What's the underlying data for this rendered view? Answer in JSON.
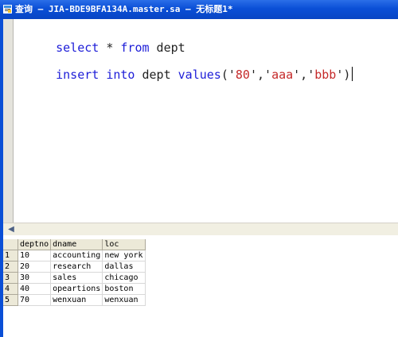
{
  "window": {
    "title": "查询 — JIA-BDE9BFA134A.master.sa — 无标题1*",
    "icon": "query-window-icon"
  },
  "editor": {
    "lines": [
      {
        "segments": [
          {
            "text": "select",
            "type": "keyword"
          },
          {
            "text": " * ",
            "type": "plain"
          },
          {
            "text": "from",
            "type": "keyword"
          },
          {
            "text": " dept",
            "type": "plain"
          }
        ]
      },
      {
        "segments": [
          {
            "text": "insert",
            "type": "keyword"
          },
          {
            "text": " ",
            "type": "plain"
          },
          {
            "text": "into",
            "type": "keyword"
          },
          {
            "text": " dept ",
            "type": "plain"
          },
          {
            "text": "values",
            "type": "keyword"
          },
          {
            "text": "('",
            "type": "plain"
          },
          {
            "text": "80",
            "type": "string"
          },
          {
            "text": "','",
            "type": "plain"
          },
          {
            "text": "aaa",
            "type": "string"
          },
          {
            "text": "','",
            "type": "plain"
          },
          {
            "text": "bbb",
            "type": "string"
          },
          {
            "text": "')",
            "type": "plain"
          }
        ]
      }
    ]
  },
  "scrollbar": {
    "left_arrow_icon": "chevron-left-icon"
  },
  "results": {
    "columns": [
      "deptno",
      "dname",
      "loc"
    ],
    "rows": [
      {
        "num": "1",
        "cells": [
          "10",
          "accounting",
          "new york"
        ]
      },
      {
        "num": "2",
        "cells": [
          "20",
          "research",
          "dallas"
        ]
      },
      {
        "num": "3",
        "cells": [
          "30",
          "sales",
          "chicago"
        ]
      },
      {
        "num": "4",
        "cells": [
          "40",
          "opeartions",
          "boston"
        ]
      },
      {
        "num": "5",
        "cells": [
          "70",
          "wenxuan",
          "wenxuan"
        ]
      }
    ]
  },
  "colors": {
    "titlebar": "#0a4fd6",
    "keyword": "#1d1dd8",
    "string": "#c52a2a"
  }
}
